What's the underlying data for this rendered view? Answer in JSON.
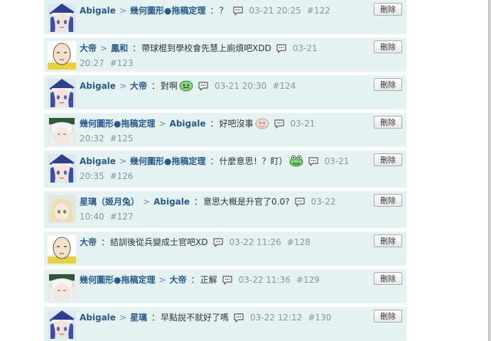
{
  "delete_label": "刪除",
  "comments": [
    {
      "avatar": "abigale-avatar",
      "from": "Abigale",
      "to": "幾何圖形●拖稿定理",
      "text": "？",
      "emoji": null,
      "time": "03-21 20:25",
      "num": "#122"
    },
    {
      "avatar": "bald-hero-avatar",
      "from": "大帝",
      "to": "鳳和",
      "text": "帶球棍到學校會先慧上廁煩吧XDD",
      "emoji": null,
      "time": "03-21 20:27",
      "num": "#123"
    },
    {
      "avatar": "abigale-avatar",
      "from": "Abigale",
      "to": "大帝",
      "text": "對啊",
      "emoji": "sweat-face",
      "time": "03-21 20:30",
      "num": "#124"
    },
    {
      "avatar": "white-hair-avatar",
      "from": "幾何圖形●拖稿定理",
      "to": "Abigale",
      "text": "好吧沒事",
      "emoji": "old-man-face",
      "time": "03-21 20:32",
      "num": "#125"
    },
    {
      "avatar": "abigale-avatar",
      "from": "Abigale",
      "to": "幾何圖形●拖稿定理",
      "text": "什麼意思！？盯）",
      "emoji": "frog-face",
      "time": "03-21 20:35",
      "num": "#126"
    },
    {
      "avatar": "elf-avatar",
      "from": "星璃（姬月兔）",
      "to": "Abigale",
      "text": "意思大概是升官了0.0?",
      "emoji": null,
      "time": "03-22 10:40",
      "num": "#127"
    },
    {
      "avatar": "bald-hero-avatar",
      "from": "大帝",
      "to": null,
      "text": "結訓後從兵變成士官吧XD",
      "emoji": null,
      "time": "03-22 11:26",
      "num": "#128"
    },
    {
      "avatar": "white-hair-avatar",
      "from": "幾何圖形●拖稿定理",
      "to": "大帝",
      "text": "正解",
      "emoji": null,
      "time": "03-22 11:36",
      "num": "#129"
    },
    {
      "avatar": "abigale-avatar",
      "from": "Abigale",
      "to": "星璃",
      "text": "早點說不就好了嗎",
      "emoji": null,
      "time": "03-22 12:12",
      "num": "#130"
    }
  ]
}
